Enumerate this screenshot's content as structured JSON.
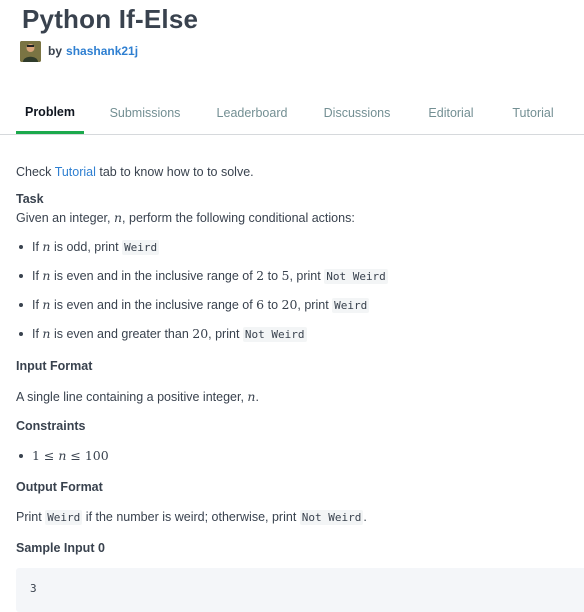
{
  "page": {
    "title": "Python If-Else",
    "by": "by",
    "author": "shashank21j"
  },
  "tabs": [
    "Problem",
    "Submissions",
    "Leaderboard",
    "Discussions",
    "Editorial",
    "Tutorial"
  ],
  "intro": {
    "before": "Check ",
    "link": "Tutorial",
    "after": " tab to know how to to solve."
  },
  "task": {
    "heading": "Task",
    "text_before": "Given an integer, ",
    "var": "n",
    "text_after": ", perform the following conditional actions:"
  },
  "rules": [
    {
      "p1": "If ",
      "v": "n",
      "p2": " is odd, print ",
      "code": "Weird"
    },
    {
      "p1": "If ",
      "v": "n",
      "p2": " is even and in the inclusive range of ",
      "a": "2",
      "to": " to ",
      "b": "5",
      "p3": ", print ",
      "code": "Not Weird"
    },
    {
      "p1": "If ",
      "v": "n",
      "p2": " is even and in the inclusive range of ",
      "a": "6",
      "to": " to ",
      "b": "20",
      "p3": ", print ",
      "code": "Weird"
    },
    {
      "p1": "If ",
      "v": "n",
      "p2": " is even and greater than ",
      "a": "20",
      "p3": ", print ",
      "code": "Not Weird"
    }
  ],
  "input_format": {
    "heading": "Input Format",
    "text_before": "A single line containing a positive integer, ",
    "var": "n",
    "text_after": "."
  },
  "constraints": {
    "heading": "Constraints",
    "lo": "1",
    "le1": " ≤ ",
    "var": "n",
    "le2": " ≤ ",
    "hi": "100"
  },
  "output_format": {
    "heading": "Output Format",
    "p1": "Print ",
    "code1": "Weird",
    "p2": " if the number is weird; otherwise, print ",
    "code2": "Not Weird",
    "p3": "."
  },
  "sample_input": {
    "heading": "Sample Input 0",
    "value": "3"
  }
}
